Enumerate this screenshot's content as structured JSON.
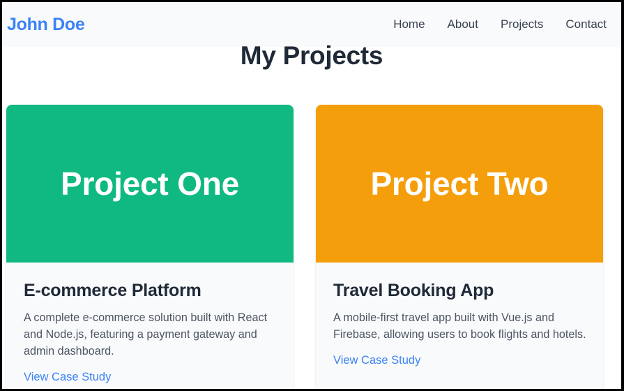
{
  "nav": {
    "brand": "John Doe",
    "links": [
      "Home",
      "About",
      "Projects",
      "Contact"
    ]
  },
  "main": {
    "heading": "My Projects",
    "projects": [
      {
        "banner": "Project One",
        "banner_color": "#10b981",
        "title": "E-commerce Platform",
        "description": "A complete e-commerce solution built with React and Node.js, featuring a payment gateway and admin dashboard.",
        "link": "View Case Study"
      },
      {
        "banner": "Project Two",
        "banner_color": "#f59e0b",
        "title": "Travel Booking App",
        "description": "A mobile-first travel app built with Vue.js and Firebase, allowing users to book flights and hotels.",
        "link": "View Case Study"
      }
    ]
  },
  "colors": {
    "accent": "#3b82f6",
    "heading": "#1f2937",
    "nav_bg": "#f9fafb"
  }
}
